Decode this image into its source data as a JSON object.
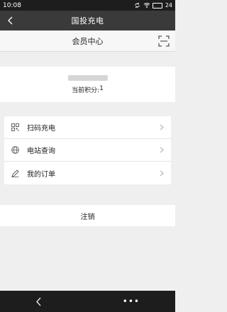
{
  "status_bar": {
    "time": "10:08",
    "battery": "24"
  },
  "title_bar": {
    "title": "国投充电"
  },
  "sub_header": {
    "title": "会员中心"
  },
  "profile": {
    "points_label": "当前积分:",
    "points_value": "1"
  },
  "menu": {
    "items": [
      {
        "label": "扫码充电",
        "icon": "qr-grid-icon"
      },
      {
        "label": "电站查询",
        "icon": "globe-icon"
      },
      {
        "label": "我的订单",
        "icon": "pen-icon"
      }
    ]
  },
  "logout": {
    "label": "注销"
  },
  "bottom_nav": {
    "more": "•••"
  },
  "colors": {
    "title_bar": "#3a3a3a",
    "status_bar": "#1d1d1d",
    "background": "#efefef"
  }
}
